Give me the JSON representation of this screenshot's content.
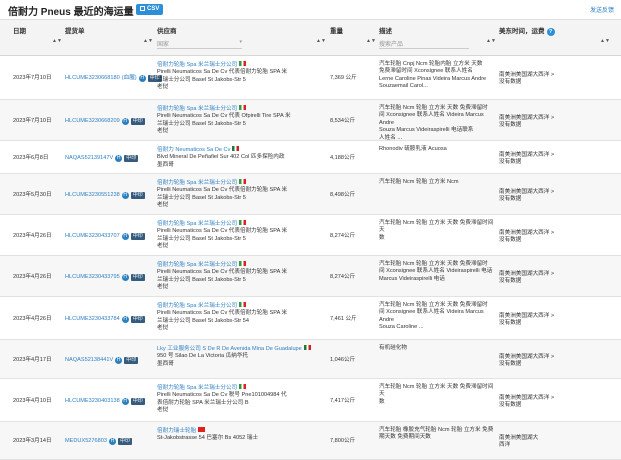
{
  "header": {
    "title": "倍耐力 Pneus 最近的海运量",
    "csv_label": "CSV",
    "feedback_label": "发送反馈"
  },
  "columns": {
    "date": "日期",
    "bol": "提货单",
    "supplier": "供应商",
    "supplier_filter": "国家",
    "weight": "重量",
    "description": "描述",
    "description_placeholder": "搜索产品",
    "destination": "美东时间，运费"
  },
  "tags": {
    "h": "H",
    "zh": "中印"
  },
  "rows": [
    {
      "date": "2023年7月10日",
      "bol": "HLCUME3230668180",
      "note": "(血腥)",
      "supplier_name": "倍耐力轮胎 Spa 米兰瑞士分公司",
      "flag": "it",
      "supplier_lines": [
        "Pirelli Neumaticos Sa De Cv 代表倍耐力轮胎 SPA 米",
        "兰瑞士分公司 Basel St Jakobs-Str 5",
        "老挝"
      ],
      "weight": "7,369 公斤",
      "desc_lines": [
        "汽车轮胎 Cnpj Ncm 轮胎内胎 立方米 天数",
        "免费滞留时间 Xconsignee 联系人姓名",
        "Lerne Caroline Pinas Videira Marcus Andre",
        "Souzaemail Carol..."
      ],
      "dest_lines": [
        "南美洲美国湖大西洋 >",
        "没有数据"
      ]
    },
    {
      "date": "2023年7月10日",
      "bol": "HLCUME3230668209",
      "note": "",
      "supplier_name": "倍耐力轮胎 Spa 米兰瑞士分公司",
      "flag": "it",
      "supplier_lines": [
        "Pirelli Neumaticos Sa De Cv 代表 Ofpirelli Tire SPA 米",
        "兰瑞士分公司 Basel St Jakobs-Str 5",
        "老挝"
      ],
      "weight": "8,534公斤",
      "desc_lines": [
        "汽车轮胎 Ncm 轮胎 立方米 天数 免费滞留时",
        "间 Xconsignee 联系人姓名 Videira Marcus Andre",
        "Souza Marcus Videiraspirelli 电话联系",
        "人姓名 ..."
      ],
      "dest_lines": [
        "南美洲美国湖大西洋 >",
        "没有数据"
      ]
    },
    {
      "date": "2023年6月8日",
      "bol": "NAQAS52139147V",
      "note": "",
      "supplier_name": "倍耐力 Neumaticos Sa De Cv",
      "flag": "mx",
      "supplier_lines": [
        "Blvd Mineral De Peñafiel Sur 402 Col 匹多探险内政",
        "墨西哥"
      ],
      "weight": "4,188公斤",
      "desc_lines": [
        "Rhonodiv 硫胺乳液 Acuosa"
      ],
      "dest_lines": [
        "南美洲美国湖大西洋 >",
        "没有数据"
      ]
    },
    {
      "date": "2023年5月30日",
      "bol": "HLCUME3230551238",
      "note": "",
      "supplier_name": "倍耐力轮胎 Spa 米兰瑞士分公司",
      "flag": "it",
      "supplier_lines": [
        "Pirelli Neumaticos Sa De Cv 代表倍耐力轮胎 SPA 米",
        "兰瑞士分公司 Basel St Jakobs-Str 5",
        "老挝"
      ],
      "weight": "8,498公斤",
      "desc_lines": [
        "汽车轮胎 Ncm 轮胎 立方米 Ncm"
      ],
      "dest_lines": [
        "南美洲美国湖大西洋 >",
        "没有数据"
      ]
    },
    {
      "date": "2023年4月26日",
      "bol": "HLCUME3230433707",
      "note": "",
      "supplier_name": "倍耐力轮胎 Spa 米兰瑞士分公司",
      "flag": "it",
      "supplier_lines": [
        "Pirelli Neumaticos Sa De Cv 代表倍耐力轮胎 SPA 米",
        "兰瑞士分公司 Basel St Jakobs-Str 5",
        "老挝"
      ],
      "weight": "8,274公斤",
      "desc_lines": [
        "汽车轮胎 Ncm 轮胎 立方米 天数 免费滞留时间天",
        "数"
      ],
      "dest_lines": [
        "南美洲美国湖大西洋 >",
        "没有数据"
      ]
    },
    {
      "date": "2023年4月26日",
      "bol": "HLCUME3230433795",
      "note": "",
      "supplier_name": "倍耐力轮胎 Spa 米兰瑞士分公司",
      "flag": "it",
      "supplier_lines": [
        "Pirelli Neumaticos Sa De Cv 代表倍耐力轮胎 SPA 米",
        "兰瑞士分公司 Basel St Jakobs-Str 5",
        "老挝"
      ],
      "weight": "8,274公斤",
      "desc_lines": [
        "汽车轮胎 Ncm 轮胎 立方米 天数 免费滞留时",
        "间 Xconsignee 联系人姓名 Videiraspirelli 电话",
        "Marcus Videiraspirelli 电话"
      ],
      "dest_lines": [
        "南美洲美国湖大西洋 >",
        "没有数据"
      ]
    },
    {
      "date": "2023年4月26日",
      "bol": "HLCUME3230433784",
      "note": "",
      "supplier_name": "倍耐力轮胎 Spa 米兰瑞士分公司",
      "flag": "it",
      "supplier_lines": [
        "Pirelli Neumaticos Sa De Cv 代表倍耐力轮胎 SPA 米",
        "兰瑞士分公司 Basel St Jakobs-Str 54",
        "老挝"
      ],
      "weight": "7,461 公斤",
      "desc_lines": [
        "汽车轮胎 Ncm 轮胎 立方米 天数 免费滞留时",
        "间 Xconsignee 联系人姓名 Videira Marcus Andre",
        "Souza Caroline ..."
      ],
      "dest_lines": [
        "南美洲美国湖大西洋 >",
        "没有数据"
      ]
    },
    {
      "date": "2023年4月17日",
      "bol": "NAQAS52138441V",
      "note": "",
      "supplier_name": "Lky 工业服务公司 S De R De Avenida Mina De Guadalupe",
      "flag": "mx",
      "supplier_lines": [
        "950 号 Silao De La Victoria 瓜纳华托",
        "墨西哥"
      ],
      "weight": "1,046公斤",
      "desc_lines": [
        "有机硅化物"
      ],
      "dest_lines": [
        "南美洲美国湖大西洋 >",
        "没有数据"
      ]
    },
    {
      "date": "2023年4月10日",
      "bol": "HLCUME3230403138",
      "note": "",
      "supplier_name": "倍耐力轮胎 Spa 米兰瑞士分公司",
      "flag": "it",
      "supplier_lines": [
        "Pirelli Neumaticos Sa De Cv 税号 Pne101004984 代",
        "表倍耐力轮胎 SPA 米兰瑞士分公司 B",
        "老挝"
      ],
      "weight": "7,417公斤",
      "desc_lines": [
        "汽车轮胎 Ncm 轮胎 立方米 天数 免费滞留时间天",
        "数"
      ],
      "dest_lines": [
        "南美洲美国湖大西洋 >",
        "没有数据"
      ]
    },
    {
      "date": "2023年3月14日",
      "bol": "MEDUX5276803",
      "note": "",
      "supplier_name": "倍耐力瑞士轮胎",
      "flag": "ch",
      "supplier_lines": [
        "St-Jakobstrasse 54 巴塞尔 Bs 4052 瑞士"
      ],
      "weight": "7,800公斤",
      "desc_lines": [
        "汽车轮胎 橡胶充气轮胎 Ncm 轮胎 立方米 免费",
        "期天数 免费期间天数"
      ],
      "dest_lines": [
        "南美洲美国湖大",
        "西洋"
      ]
    }
  ]
}
